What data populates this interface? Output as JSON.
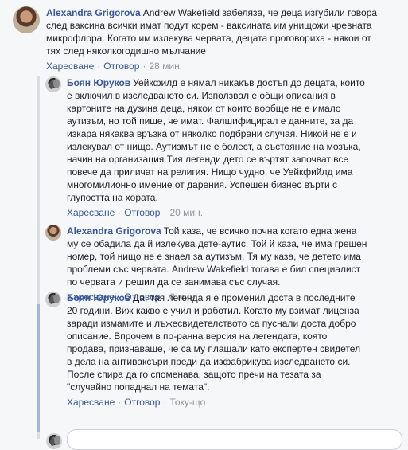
{
  "comments": [
    {
      "author": "Alexandra Grigorova",
      "text": "Andrew Wakefield забеляза, че деца изгубили говора след ваксина всички имат подут корем - ваксината им унищожи чревната микрофлора. Когато им излекува червата, децата проговориха - някои от тях след няколкогодишно мълчание",
      "lines": [
        "Andrew Wakefield забеляза, че деца изгубили говора",
        "след ваксина всички имат подут корем - ваксината им унищожи чревната",
        "микрофлора. Когато им излекува червата, децата проговориха - някои от",
        "тях след няколкогодишно мълчание"
      ],
      "like": "Харесване",
      "reply": "Отговор",
      "time": "28 мин."
    },
    {
      "author": "Боян Юруков",
      "lines": [
        "Уейкфилд е нямал никакъв достъп до децата, които",
        "е включил в изследването си. Използвал е общи описания в",
        "картоните на дузина деца, някои от които вообще не е имало",
        "аутизъм, но той пише, че имат. Фалшифицирал е данните, за да",
        "изкара някаква връзка от няколко подбрани случая. Никой не е и",
        "излекувал от нищо. Аутизмът не е болест, а състояние на мозъка,",
        "начин на организация.Тия легенди дето се въртят започват все",
        "повече да приличат на религия. Нищо чудно, че Уейкфийлд има",
        "многомилионно имение от дарения. Успешен бизнес върти с",
        "глупостта на хората."
      ],
      "like": "Харесване",
      "reply": "Отговор",
      "time": "20 мин."
    },
    {
      "author": "Alexandra Grigorova",
      "lines": [
        "Той каза, че всичко почна когато една жена",
        "му се обадила да й излекува дете-аутис. Той й каза, че има грешен",
        "номер, той нищо не е знаел за аутизъм. Тя му каза, че детето има",
        "проблеми със червата. Andrew Wakefield тогава е бил специалист",
        "по червата и решил да се занимава със случая."
      ],
      "like": "Харесване",
      "reply": "Отговор",
      "time": "8 мин."
    },
    {
      "author": "Боян Юруков",
      "lines": [
        "Да, тая легенда я е променил доста в последните",
        "20 години. Виж какво е учил и работил. Когато му взимат лиценза",
        "заради измамите и лъжесвидетелството са пуснали доста добро",
        "описание. Впрочем в по-ранна версия на легендата, която",
        "продава, признаваше, че са му плащали като експертен свидетел",
        "в дела на антиваксъри преди да изфабрикува изследването си.",
        "После спира да го споменава, защото пречи на тезата за",
        "\"случайно попаднал на темата\"."
      ],
      "like": "Харесване",
      "reply": "Отговор",
      "time": "Току-що"
    }
  ],
  "ui": {
    "separator": "·"
  }
}
